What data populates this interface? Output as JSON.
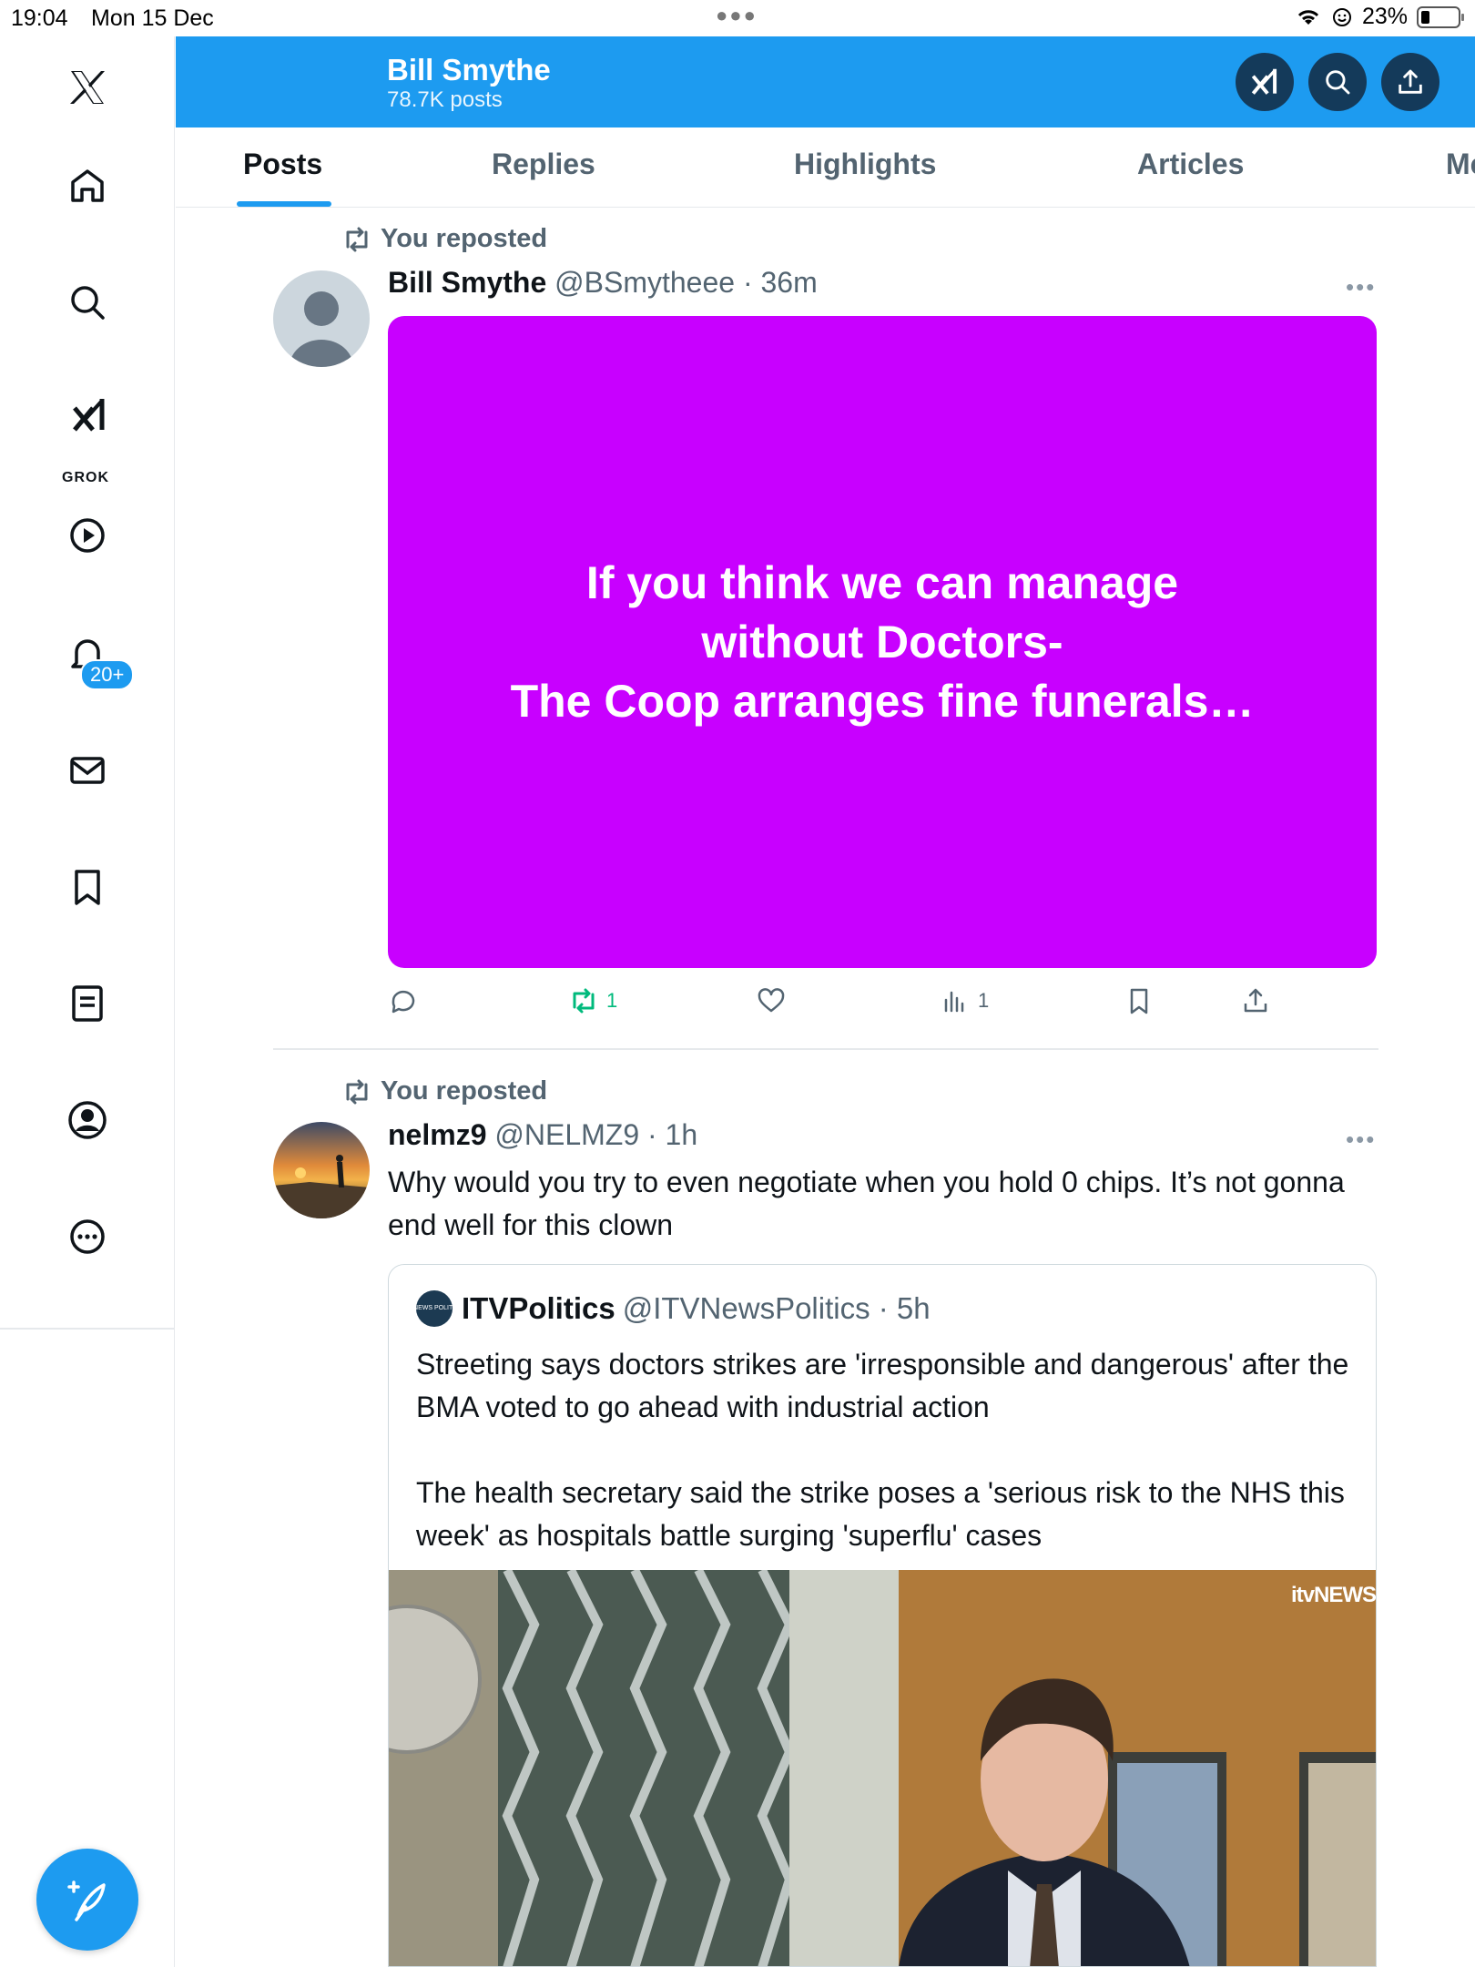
{
  "status_bar": {
    "time": "19:04",
    "date": "Mon 15 Dec",
    "battery": "23%"
  },
  "sidebar": {
    "items": [
      {
        "name": "x-logo-icon"
      },
      {
        "name": "home-icon"
      },
      {
        "name": "search-icon"
      },
      {
        "name": "grok-icon",
        "label": "GROK"
      },
      {
        "name": "video-icon"
      },
      {
        "name": "notifications-icon",
        "badge": "20+"
      },
      {
        "name": "messages-icon"
      },
      {
        "name": "bookmarks-icon"
      },
      {
        "name": "lists-icon"
      },
      {
        "name": "profile-icon"
      },
      {
        "name": "more-icon"
      }
    ]
  },
  "header": {
    "name": "Bill Smythe",
    "posts": "78.7K posts"
  },
  "tabs": [
    "Posts",
    "Replies",
    "Highlights",
    "Articles",
    "Media"
  ],
  "feed": [
    {
      "repost_label": "You reposted",
      "display_name": "Bill Smythe",
      "handle": "@BSmytheee · 36m",
      "card_text": "If you think we can manage without Doctors- The Coop arranges fine funerals…",
      "card_lines": [
        "If you think we can manage",
        "without Doctors-",
        "The Coop arranges fine funerals…"
      ],
      "card_color": "#c800ff",
      "reposts": "1",
      "views": "1"
    },
    {
      "repost_label": "You reposted",
      "display_name": "nelmz9",
      "handle": "@NELMZ9 · 1h",
      "text": "Why would you try to even negotiate when you hold 0 chips. It’s not gonna end well for this clown",
      "quote": {
        "display_name": "ITVPolitics",
        "handle": "@ITVNewsPolitics · 5h",
        "avatar_text": "itv NEWS POLITICS",
        "text_p1": "Streeting says doctors strikes are 'irresponsible and dangerous' after the BMA voted to go ahead with industrial action",
        "text_p2": "The health secretary said the strike poses a 'serious risk to the NHS this week' as hospitals battle surging 'superflu' cases",
        "image_logo": "itvNEWS"
      }
    }
  ],
  "colors": {
    "accent": "#1d9bf0",
    "repost_green": "#00ba7c"
  }
}
